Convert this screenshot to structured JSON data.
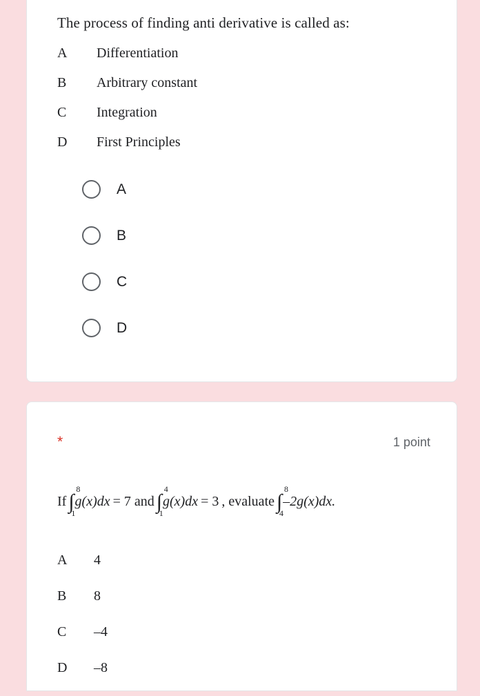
{
  "theme": {
    "page_background": "#fadde0",
    "card_background": "#ffffff",
    "text_color": "#202124",
    "muted_color": "#5f6368",
    "required_color": "#d93025"
  },
  "question1": {
    "stem": "The process of finding anti derivative is called as:",
    "options": [
      {
        "letter": "A",
        "text": "Differentiation"
      },
      {
        "letter": "B",
        "text": "Arbitrary constant"
      },
      {
        "letter": "C",
        "text": "Integration"
      },
      {
        "letter": "D",
        "text": "First Principles"
      }
    ],
    "choices": [
      {
        "label": "A",
        "selected": false
      },
      {
        "label": "B",
        "selected": false
      },
      {
        "label": "C",
        "selected": false
      },
      {
        "label": "D",
        "selected": false
      }
    ]
  },
  "question2": {
    "required_marker": "*",
    "points": "1 point",
    "math": {
      "prefix": "If",
      "integral1": {
        "lower": "1",
        "upper": "8",
        "body": "g(x)dx",
        "equals": "= 7"
      },
      "conjunction": "and",
      "integral2": {
        "lower": "1",
        "upper": "4",
        "body": "g(x)dx",
        "equals": "= 3"
      },
      "comma": ",",
      "verb": "evaluate",
      "integral3": {
        "lower": "4",
        "upper": "8",
        "body": "–2g(x)dx."
      },
      "plain_text": "If ∫₁⁸ g(x)dx = 7 and ∫₁⁴ g(x)dx = 3 , evaluate ∫₄⁸ –2g(x)dx."
    },
    "options": [
      {
        "letter": "A",
        "text": "4"
      },
      {
        "letter": "B",
        "text": "8"
      },
      {
        "letter": "C",
        "text": "–4"
      },
      {
        "letter": "D",
        "text": "–8"
      }
    ]
  }
}
